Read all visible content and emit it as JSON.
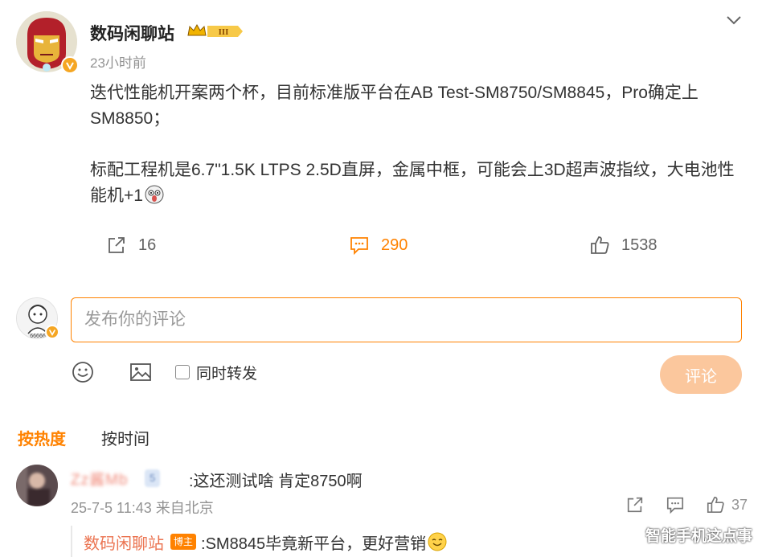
{
  "post": {
    "author": "数码闲聊站",
    "level_badge": "III",
    "time": "23小时前",
    "paragraphs": [
      "迭代性能机开案两个杯，目前标准版平台在AB Test-SM8750/SM8845，Pro确定上SM8850；",
      "标配工程机是6.7\"1.5K LTPS 2.5D直屏，金属中框，可能会上3D超声波指纹，大电池性能机+1"
    ],
    "emoji": "shocked-emoji",
    "reposts": "16",
    "comments": "290",
    "likes": "1538",
    "accent_color": "#ff8200"
  },
  "editor": {
    "placeholder": "发布你的评论",
    "repost_label": "同时转发",
    "submit_label": "评论"
  },
  "sort": {
    "hot": "按热度",
    "time": "按时间"
  },
  "comment": {
    "user": "Zz酱Mb",
    "level": "5",
    "text": ":这还测试啥  肯定8750啊",
    "meta": "25-7-5 11:43 来自北京",
    "likes": "37",
    "reply": {
      "user": "数码闲聊站",
      "tag": "博主",
      "text": ":SM8845毕竟新平台，更好营销"
    }
  },
  "watermark": "智能手机这点事"
}
